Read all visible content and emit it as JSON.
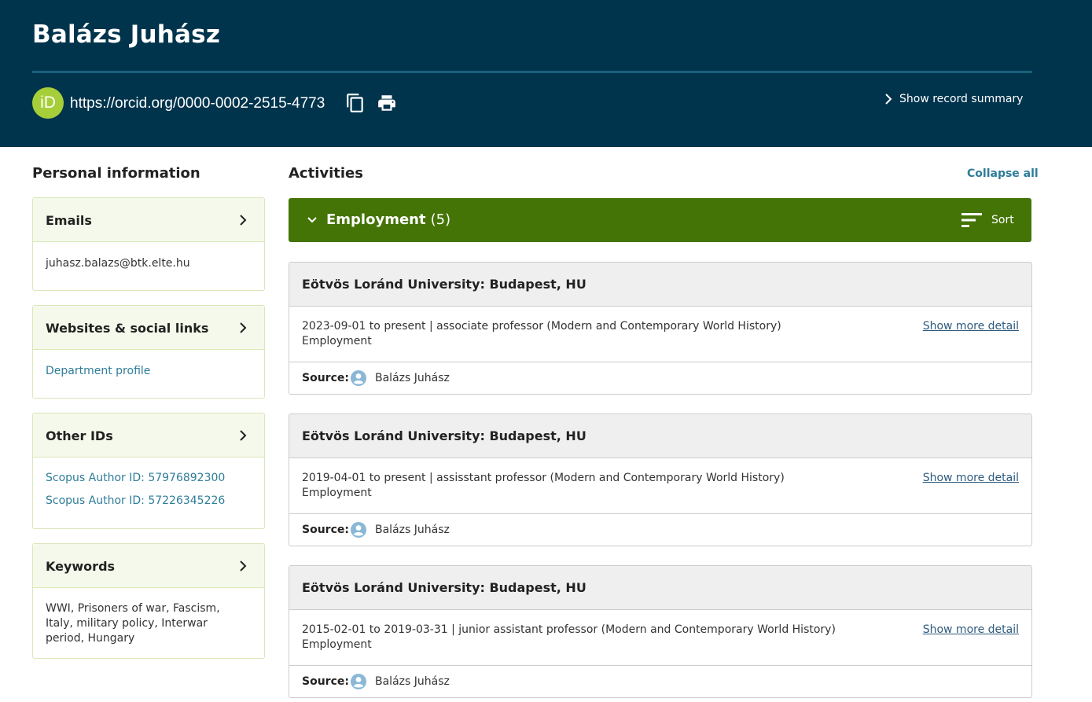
{
  "header": {
    "name": "Balázs Juhász",
    "orcid_logo_text": "iD",
    "orcid_url": "https://orcid.org/0000-0002-2515-4773",
    "copy_icon": "copy-icon",
    "print_icon": "print-icon",
    "summary_label": "Show record summary",
    "bg_color": "#00344d"
  },
  "personal": {
    "title": "Personal information",
    "emails": {
      "title": "Emails",
      "items": [
        "juhasz.balazs@btk.elte.hu"
      ]
    },
    "websites": {
      "title": "Websites & social links",
      "items": [
        "Department profile"
      ]
    },
    "other_ids": {
      "title": "Other IDs",
      "items": [
        "Scopus Author ID: 57976892300",
        "Scopus Author ID: 57226345226"
      ]
    },
    "keywords": {
      "title": "Keywords",
      "text": "WWI, Prisoners of war, Fascism, Italy, military policy, Interwar period, Hungary"
    }
  },
  "activities": {
    "title": "Activities",
    "collapse_label": "Collapse all",
    "employment": {
      "title": "Employment",
      "count": "(5)",
      "sort_label": "Sort",
      "bar_color": "#447405",
      "items": [
        {
          "org": "Eötvös Loránd University: Budapest, HU",
          "line1": "2023-09-01 to present | associate professor (Modern and Contemporary World History)",
          "line2": "Employment",
          "more": "Show more detail",
          "source_label": "Source",
          "source_name": "Balázs Juhász"
        },
        {
          "org": "Eötvös Loránd University: Budapest, HU",
          "line1": "2019-04-01 to present | assisstant professor (Modern and Contemporary World History)",
          "line2": "Employment",
          "more": "Show more detail",
          "source_label": "Source",
          "source_name": "Balázs Juhász"
        },
        {
          "org": "Eötvös Loránd University: Budapest, HU",
          "line1": "2015-02-01 to 2019-03-31 | junior assistant professor (Modern and Contemporary World History)",
          "line2": "Employment",
          "more": "Show more detail",
          "source_label": "Source",
          "source_name": "Balázs Juhász"
        }
      ]
    }
  }
}
